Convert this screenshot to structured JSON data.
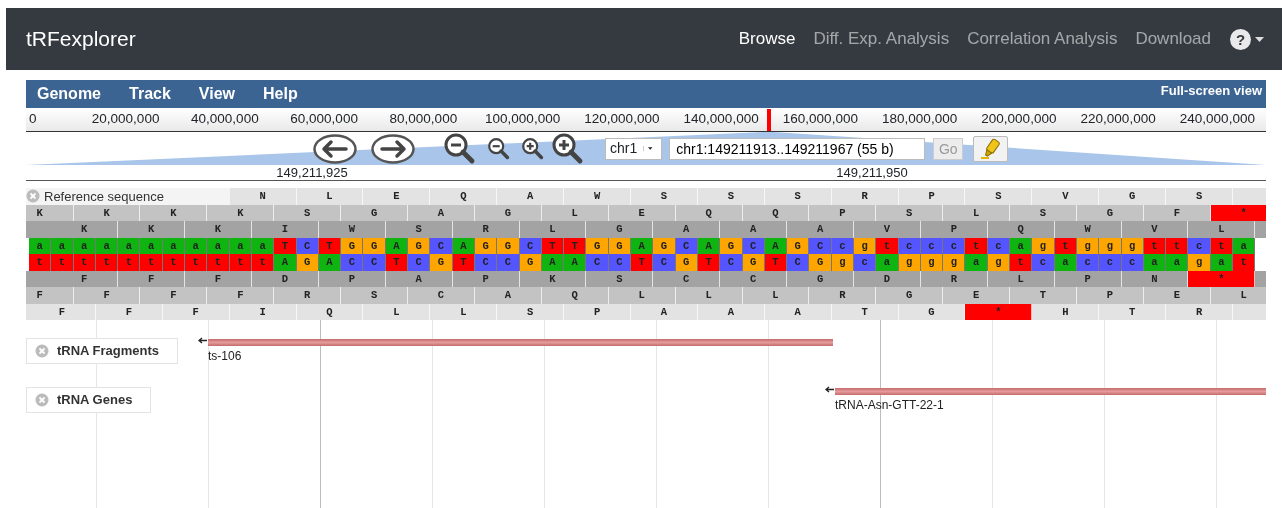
{
  "navbar": {
    "brand": "tRFexplorer",
    "links": [
      {
        "label": "Browse",
        "selected": true
      },
      {
        "label": "Diff. Exp. Analysis",
        "selected": false
      },
      {
        "label": "Correlation Analysis",
        "selected": false
      },
      {
        "label": "Download",
        "selected": false
      }
    ],
    "help_label": "?"
  },
  "browser": {
    "menu": [
      "Genome",
      "Track",
      "View",
      "Help"
    ],
    "fullscreen_link": "Full-screen view",
    "overview_ruler": [
      "0",
      "20,000,000",
      "40,000,000",
      "60,000,000",
      "80,000,000",
      "100,000,000",
      "120,000,000",
      "140,000,000",
      "160,000,000",
      "180,000,000",
      "200,000,000",
      "220,000,000",
      "240,000,000"
    ],
    "navigation": {
      "chromosome": "chr1",
      "location": "chr1:149211913..149211967 (55 b)",
      "go_button": {
        "label": "Go",
        "disabled": true
      }
    },
    "detail_ruler": [
      "149,211,925",
      "149,211,950"
    ],
    "tracks": [
      {
        "kind": "sequence",
        "label": "Reference sequence",
        "forward_frames": [
          [
            {
              "aa": "N",
              "stop": false
            },
            {
              "aa": "L",
              "stop": false
            },
            {
              "aa": "E",
              "stop": false
            },
            {
              "aa": "Q",
              "stop": false
            },
            {
              "aa": "A",
              "stop": false
            },
            {
              "aa": "W",
              "stop": false
            },
            {
              "aa": "S",
              "stop": false
            },
            {
              "aa": "S",
              "stop": false
            },
            {
              "aa": "S",
              "stop": false
            },
            {
              "aa": "R",
              "stop": false
            },
            {
              "aa": "P",
              "stop": false
            },
            {
              "aa": "S",
              "stop": false
            },
            {
              "aa": "V",
              "stop": false
            },
            {
              "aa": "G",
              "stop": false
            },
            {
              "aa": "S",
              "stop": false
            }
          ],
          [
            {
              "aa": "K",
              "stop": false
            },
            {
              "aa": "K",
              "stop": false
            },
            {
              "aa": "K",
              "stop": false
            },
            {
              "aa": "K",
              "stop": false
            },
            {
              "aa": "S",
              "stop": false
            },
            {
              "aa": "G",
              "stop": false
            },
            {
              "aa": "A",
              "stop": false
            },
            {
              "aa": "G",
              "stop": false
            },
            {
              "aa": "L",
              "stop": false
            },
            {
              "aa": "E",
              "stop": false
            },
            {
              "aa": "Q",
              "stop": false
            },
            {
              "aa": "Q",
              "stop": false
            },
            {
              "aa": "P",
              "stop": false
            },
            {
              "aa": "S",
              "stop": false
            },
            {
              "aa": "L",
              "stop": false
            },
            {
              "aa": "S",
              "stop": false
            },
            {
              "aa": "G",
              "stop": false
            },
            {
              "aa": "F",
              "stop": false
            },
            {
              "aa": "*",
              "stop": true
            }
          ],
          [
            {
              "aa": "K",
              "stop": false
            },
            {
              "aa": "K",
              "stop": false
            },
            {
              "aa": "K",
              "stop": false
            },
            {
              "aa": "I",
              "stop": false
            },
            {
              "aa": "W",
              "stop": false
            },
            {
              "aa": "S",
              "stop": false
            },
            {
              "aa": "R",
              "stop": false
            },
            {
              "aa": "L",
              "stop": false
            },
            {
              "aa": "G",
              "stop": false
            },
            {
              "aa": "A",
              "stop": false
            },
            {
              "aa": "A",
              "stop": false
            },
            {
              "aa": "A",
              "stop": false
            },
            {
              "aa": "V",
              "stop": false
            },
            {
              "aa": "P",
              "stop": false
            },
            {
              "aa": "Q",
              "stop": false
            },
            {
              "aa": "W",
              "stop": false
            },
            {
              "aa": "V",
              "stop": false
            },
            {
              "aa": "L",
              "stop": false
            }
          ]
        ],
        "forward_strand": [
          {
            "base": "a",
            "color": "#10b410"
          },
          {
            "base": "a",
            "color": "#10b410"
          },
          {
            "base": "a",
            "color": "#10b410"
          },
          {
            "base": "a",
            "color": "#10b410"
          },
          {
            "base": "a",
            "color": "#10b410"
          },
          {
            "base": "a",
            "color": "#10b410"
          },
          {
            "base": "a",
            "color": "#10b410"
          },
          {
            "base": "a",
            "color": "#10b410"
          },
          {
            "base": "a",
            "color": "#10b410"
          },
          {
            "base": "a",
            "color": "#10b410"
          },
          {
            "base": "a",
            "color": "#10b410"
          },
          {
            "base": "T",
            "color": "#ff0000"
          },
          {
            "base": "C",
            "color": "#5555ff"
          },
          {
            "base": "T",
            "color": "#ff0000"
          },
          {
            "base": "G",
            "color": "#ffa500"
          },
          {
            "base": "G",
            "color": "#ffa500"
          },
          {
            "base": "A",
            "color": "#10b410"
          },
          {
            "base": "G",
            "color": "#ffa500"
          },
          {
            "base": "C",
            "color": "#5555ff"
          },
          {
            "base": "A",
            "color": "#10b410"
          },
          {
            "base": "G",
            "color": "#ffa500"
          },
          {
            "base": "G",
            "color": "#ffa500"
          },
          {
            "base": "C",
            "color": "#5555ff"
          },
          {
            "base": "T",
            "color": "#ff0000"
          },
          {
            "base": "T",
            "color": "#ff0000"
          },
          {
            "base": "G",
            "color": "#ffa500"
          },
          {
            "base": "G",
            "color": "#ffa500"
          },
          {
            "base": "A",
            "color": "#10b410"
          },
          {
            "base": "G",
            "color": "#ffa500"
          },
          {
            "base": "C",
            "color": "#5555ff"
          },
          {
            "base": "A",
            "color": "#10b410"
          },
          {
            "base": "G",
            "color": "#ffa500"
          },
          {
            "base": "C",
            "color": "#5555ff"
          },
          {
            "base": "A",
            "color": "#10b410"
          },
          {
            "base": "G",
            "color": "#ffa500"
          },
          {
            "base": "C",
            "color": "#5555ff"
          },
          {
            "base": "c",
            "color": "#5555ff"
          },
          {
            "base": "g",
            "color": "#ffa500"
          },
          {
            "base": "t",
            "color": "#ff0000"
          },
          {
            "base": "c",
            "color": "#5555ff"
          },
          {
            "base": "c",
            "color": "#5555ff"
          },
          {
            "base": "c",
            "color": "#5555ff"
          },
          {
            "base": "t",
            "color": "#ff0000"
          },
          {
            "base": "c",
            "color": "#5555ff"
          },
          {
            "base": "a",
            "color": "#10b410"
          },
          {
            "base": "g",
            "color": "#ffa500"
          },
          {
            "base": "t",
            "color": "#ff0000"
          },
          {
            "base": "g",
            "color": "#ffa500"
          },
          {
            "base": "g",
            "color": "#ffa500"
          },
          {
            "base": "g",
            "color": "#ffa500"
          },
          {
            "base": "t",
            "color": "#ff0000"
          },
          {
            "base": "t",
            "color": "#ff0000"
          },
          {
            "base": "c",
            "color": "#5555ff"
          },
          {
            "base": "t",
            "color": "#ff0000"
          },
          {
            "base": "a",
            "color": "#10b410"
          }
        ],
        "reverse_strand": [
          {
            "base": "t",
            "color": "#ff0000"
          },
          {
            "base": "t",
            "color": "#ff0000"
          },
          {
            "base": "t",
            "color": "#ff0000"
          },
          {
            "base": "t",
            "color": "#ff0000"
          },
          {
            "base": "t",
            "color": "#ff0000"
          },
          {
            "base": "t",
            "color": "#ff0000"
          },
          {
            "base": "t",
            "color": "#ff0000"
          },
          {
            "base": "t",
            "color": "#ff0000"
          },
          {
            "base": "t",
            "color": "#ff0000"
          },
          {
            "base": "t",
            "color": "#ff0000"
          },
          {
            "base": "t",
            "color": "#ff0000"
          },
          {
            "base": "A",
            "color": "#10b410"
          },
          {
            "base": "G",
            "color": "#ffa500"
          },
          {
            "base": "A",
            "color": "#10b410"
          },
          {
            "base": "C",
            "color": "#5555ff"
          },
          {
            "base": "C",
            "color": "#5555ff"
          },
          {
            "base": "T",
            "color": "#ff0000"
          },
          {
            "base": "C",
            "color": "#5555ff"
          },
          {
            "base": "G",
            "color": "#ffa500"
          },
          {
            "base": "T",
            "color": "#ff0000"
          },
          {
            "base": "C",
            "color": "#5555ff"
          },
          {
            "base": "C",
            "color": "#5555ff"
          },
          {
            "base": "G",
            "color": "#ffa500"
          },
          {
            "base": "A",
            "color": "#10b410"
          },
          {
            "base": "A",
            "color": "#10b410"
          },
          {
            "base": "C",
            "color": "#5555ff"
          },
          {
            "base": "C",
            "color": "#5555ff"
          },
          {
            "base": "T",
            "color": "#ff0000"
          },
          {
            "base": "C",
            "color": "#5555ff"
          },
          {
            "base": "G",
            "color": "#ffa500"
          },
          {
            "base": "T",
            "color": "#ff0000"
          },
          {
            "base": "C",
            "color": "#5555ff"
          },
          {
            "base": "G",
            "color": "#ffa500"
          },
          {
            "base": "T",
            "color": "#ff0000"
          },
          {
            "base": "C",
            "color": "#5555ff"
          },
          {
            "base": "G",
            "color": "#ffa500"
          },
          {
            "base": "g",
            "color": "#ffa500"
          },
          {
            "base": "c",
            "color": "#5555ff"
          },
          {
            "base": "a",
            "color": "#10b410"
          },
          {
            "base": "g",
            "color": "#ffa500"
          },
          {
            "base": "g",
            "color": "#ffa500"
          },
          {
            "base": "g",
            "color": "#ffa500"
          },
          {
            "base": "a",
            "color": "#10b410"
          },
          {
            "base": "g",
            "color": "#ffa500"
          },
          {
            "base": "t",
            "color": "#ff0000"
          },
          {
            "base": "c",
            "color": "#5555ff"
          },
          {
            "base": "a",
            "color": "#10b410"
          },
          {
            "base": "c",
            "color": "#5555ff"
          },
          {
            "base": "c",
            "color": "#5555ff"
          },
          {
            "base": "c",
            "color": "#5555ff"
          },
          {
            "base": "a",
            "color": "#10b410"
          },
          {
            "base": "a",
            "color": "#10b410"
          },
          {
            "base": "g",
            "color": "#ffa500"
          },
          {
            "base": "a",
            "color": "#10b410"
          },
          {
            "base": "t",
            "color": "#ff0000"
          }
        ],
        "reverse_frames": [
          [
            {
              "aa": "F",
              "stop": false
            },
            {
              "aa": "F",
              "stop": false
            },
            {
              "aa": "F",
              "stop": false
            },
            {
              "aa": "D",
              "stop": false
            },
            {
              "aa": "P",
              "stop": false
            },
            {
              "aa": "A",
              "stop": false
            },
            {
              "aa": "P",
              "stop": false
            },
            {
              "aa": "K",
              "stop": false
            },
            {
              "aa": "S",
              "stop": false
            },
            {
              "aa": "C",
              "stop": false
            },
            {
              "aa": "C",
              "stop": false
            },
            {
              "aa": "G",
              "stop": false
            },
            {
              "aa": "D",
              "stop": false
            },
            {
              "aa": "R",
              "stop": false
            },
            {
              "aa": "L",
              "stop": false
            },
            {
              "aa": "P",
              "stop": false
            },
            {
              "aa": "N",
              "stop": false
            },
            {
              "aa": "*",
              "stop": true
            }
          ],
          [
            {
              "aa": "F",
              "stop": false
            },
            {
              "aa": "F",
              "stop": false
            },
            {
              "aa": "F",
              "stop": false
            },
            {
              "aa": "F",
              "stop": false
            },
            {
              "aa": "R",
              "stop": false
            },
            {
              "aa": "S",
              "stop": false
            },
            {
              "aa": "C",
              "stop": false
            },
            {
              "aa": "A",
              "stop": false
            },
            {
              "aa": "Q",
              "stop": false
            },
            {
              "aa": "L",
              "stop": false
            },
            {
              "aa": "L",
              "stop": false
            },
            {
              "aa": "L",
              "stop": false
            },
            {
              "aa": "R",
              "stop": false
            },
            {
              "aa": "G",
              "stop": false
            },
            {
              "aa": "E",
              "stop": false
            },
            {
              "aa": "T",
              "stop": false
            },
            {
              "aa": "P",
              "stop": false
            },
            {
              "aa": "E",
              "stop": false
            },
            {
              "aa": "L",
              "stop": false
            }
          ],
          [
            {
              "aa": "F",
              "stop": false
            },
            {
              "aa": "F",
              "stop": false
            },
            {
              "aa": "F",
              "stop": false
            },
            {
              "aa": "I",
              "stop": false
            },
            {
              "aa": "Q",
              "stop": false
            },
            {
              "aa": "L",
              "stop": false
            },
            {
              "aa": "L",
              "stop": false
            },
            {
              "aa": "S",
              "stop": false
            },
            {
              "aa": "P",
              "stop": false
            },
            {
              "aa": "A",
              "stop": false
            },
            {
              "aa": "A",
              "stop": false
            },
            {
              "aa": "A",
              "stop": false
            },
            {
              "aa": "T",
              "stop": false
            },
            {
              "aa": "G",
              "stop": false
            },
            {
              "aa": "*",
              "stop": true
            },
            {
              "aa": "H",
              "stop": false
            },
            {
              "aa": "T",
              "stop": false
            },
            {
              "aa": "R",
              "stop": false
            }
          ]
        ]
      },
      {
        "kind": "features",
        "label": "tRNA Fragments",
        "features": [
          {
            "name": "ts-106",
            "reverse_strand": true
          }
        ]
      },
      {
        "kind": "features",
        "label": "tRNA Genes",
        "features": [
          {
            "name": "tRNA-Asn-GTT-22-1",
            "reverse_strand": true
          }
        ]
      }
    ]
  }
}
